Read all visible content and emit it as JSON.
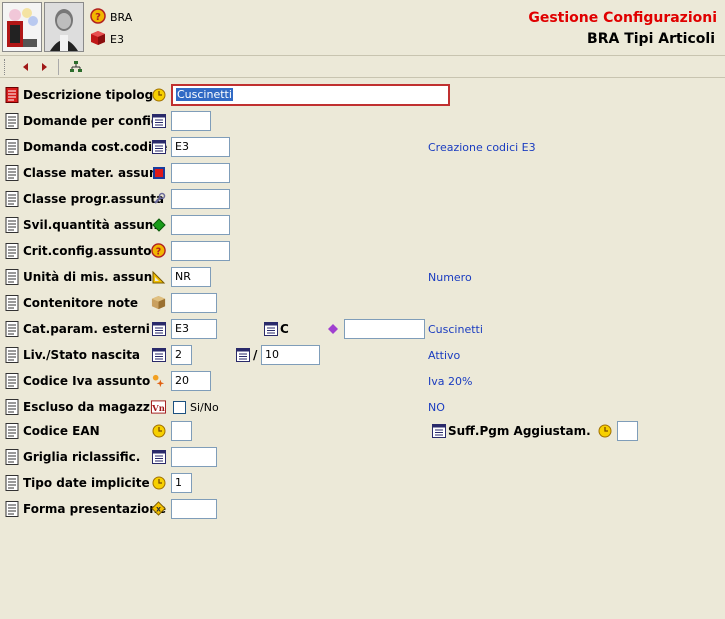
{
  "header": {
    "title": "Gestione Configurazioni",
    "subtitle": "BRA Tipi Articoli",
    "item1": {
      "icon": "question-circle-icon",
      "label": "BRA"
    },
    "item2": {
      "icon": "red-cube-icon",
      "label": "E3"
    }
  },
  "toolbar": {
    "prev_icon": "arrow-left-icon",
    "next_icon": "arrow-right-icon",
    "tree_icon": "hierarchy-icon"
  },
  "form": {
    "rows": [
      {
        "label": "Descrizione tipolog.",
        "icon": "clock-icon",
        "value": "Cuscinetti",
        "desc": ""
      },
      {
        "label": "Domande per config.",
        "icon": "table-icon",
        "value": "",
        "desc": ""
      },
      {
        "label": "Domanda cost.codice",
        "icon": "table-icon",
        "value": "E3",
        "desc": "Creazione codici E3"
      },
      {
        "label": "Classe mater. assun.",
        "icon": "red-square-icon",
        "value": "",
        "desc": ""
      },
      {
        "label": "Classe progr.assunta",
        "icon": "wrench-icon",
        "value": "",
        "desc": ""
      },
      {
        "label": "Svil.quantità assun.",
        "icon": "green-diamond-icon",
        "value": "",
        "desc": ""
      },
      {
        "label": "Crit.config.assunto",
        "icon": "question-circle-icon",
        "value": "",
        "desc": ""
      },
      {
        "label": "Unità di mis. assun.",
        "icon": "ruler-triangle-icon",
        "value": "NR",
        "desc": "Numero"
      },
      {
        "label": "Contenitore note",
        "icon": "box-icon",
        "value": "",
        "desc": ""
      },
      {
        "label": "Cat.param. esterni",
        "icon": "table-icon",
        "value": "E3",
        "desc": "Cuscinetti",
        "extra_label": "C",
        "extra_icon": "purple-diamond-icon",
        "extra_value": ""
      },
      {
        "label": "Liv./Stato nascita",
        "icon": "table-icon",
        "value": "2",
        "desc": "Attivo",
        "sep": "/",
        "value2": "10"
      },
      {
        "label": "Codice Iva assunto",
        "icon": "sparkle-icon",
        "value": "20",
        "desc": "Iva 20%"
      },
      {
        "label": "Escluso da magazz.",
        "icon": "vn-icon",
        "checkbox_label": "Si/No",
        "checked": false,
        "desc": "NO"
      },
      {
        "label": "Codice EAN",
        "icon": "clock-icon",
        "value": "",
        "desc": "",
        "extra_label": "Suff.Pgm Aggiustam.",
        "extra_icon": "clock-icon",
        "extra_value": ""
      },
      {
        "label": "Griglia riclassific.",
        "icon": "table-icon",
        "value": "",
        "desc": ""
      },
      {
        "label": "Tipo date implicite",
        "icon": "clock-icon",
        "value": "1",
        "desc": ""
      },
      {
        "label": "Forma presentazione",
        "icon": "warning-x-icon",
        "value": "",
        "desc": ""
      }
    ]
  }
}
